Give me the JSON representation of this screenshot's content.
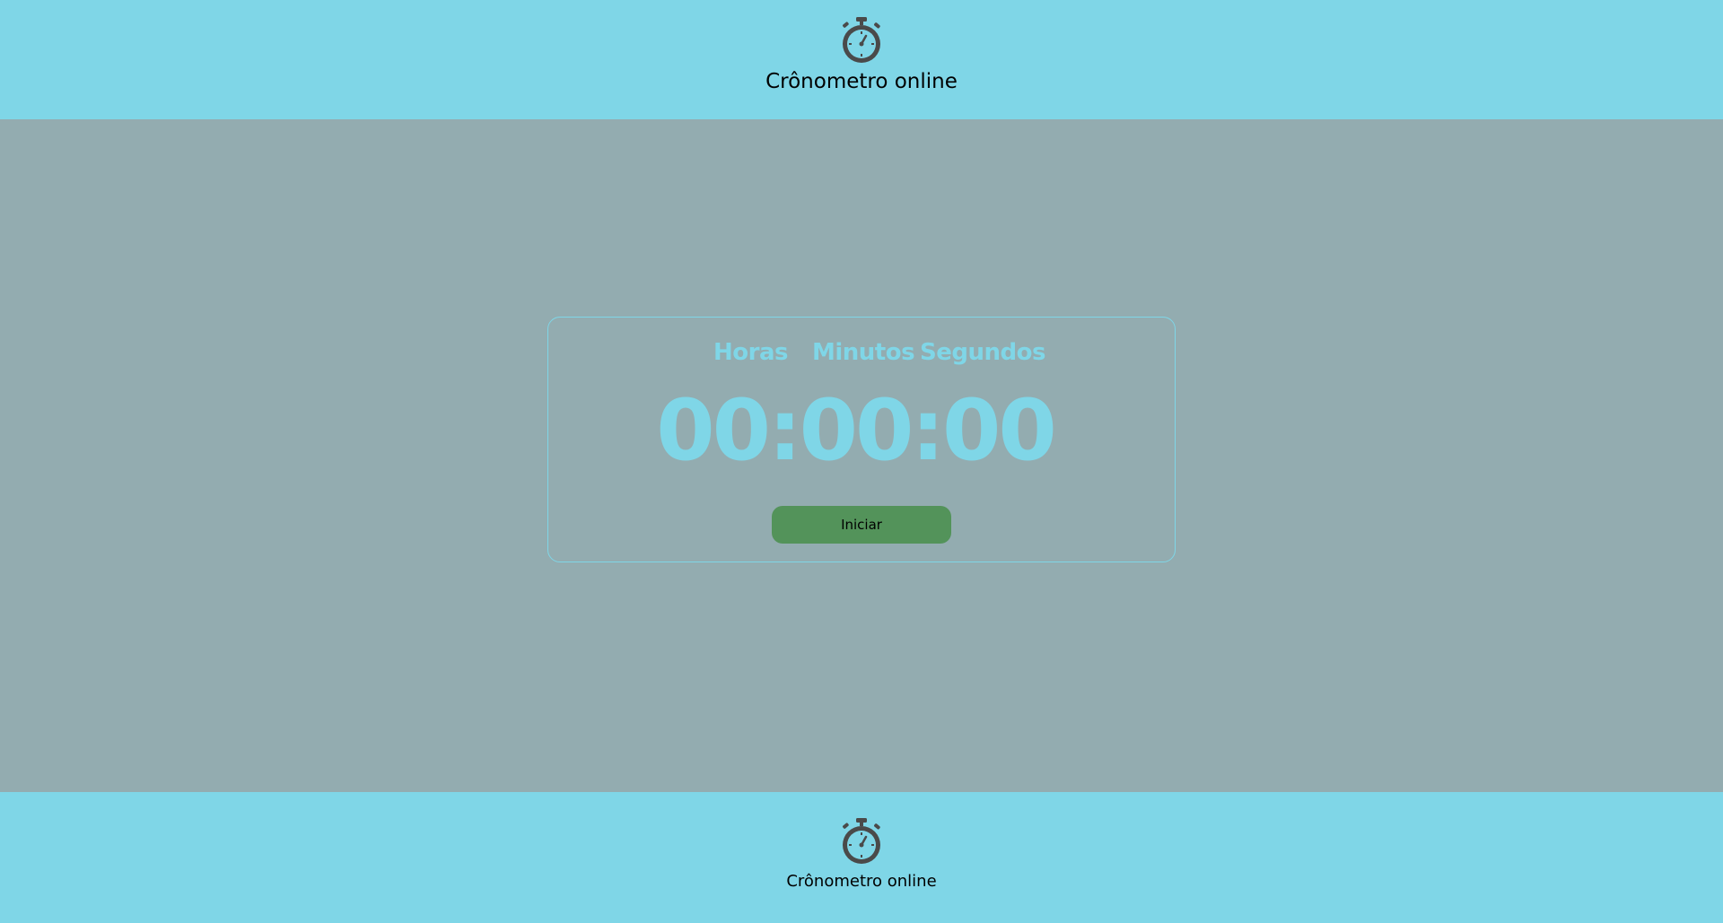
{
  "header": {
    "title": "Crônometro online",
    "icon": "stopwatch-icon"
  },
  "timer": {
    "labels": {
      "hours": "Horas",
      "minutes": "Minutos",
      "seconds": "Segundos"
    },
    "display": "00:00:00",
    "start_label": "Iniciar"
  },
  "footer": {
    "title": "Crônometro online",
    "icon": "stopwatch-icon"
  },
  "colors": {
    "accent": "#7fd6e7",
    "background": "#93acb0",
    "button": "#53935a"
  }
}
